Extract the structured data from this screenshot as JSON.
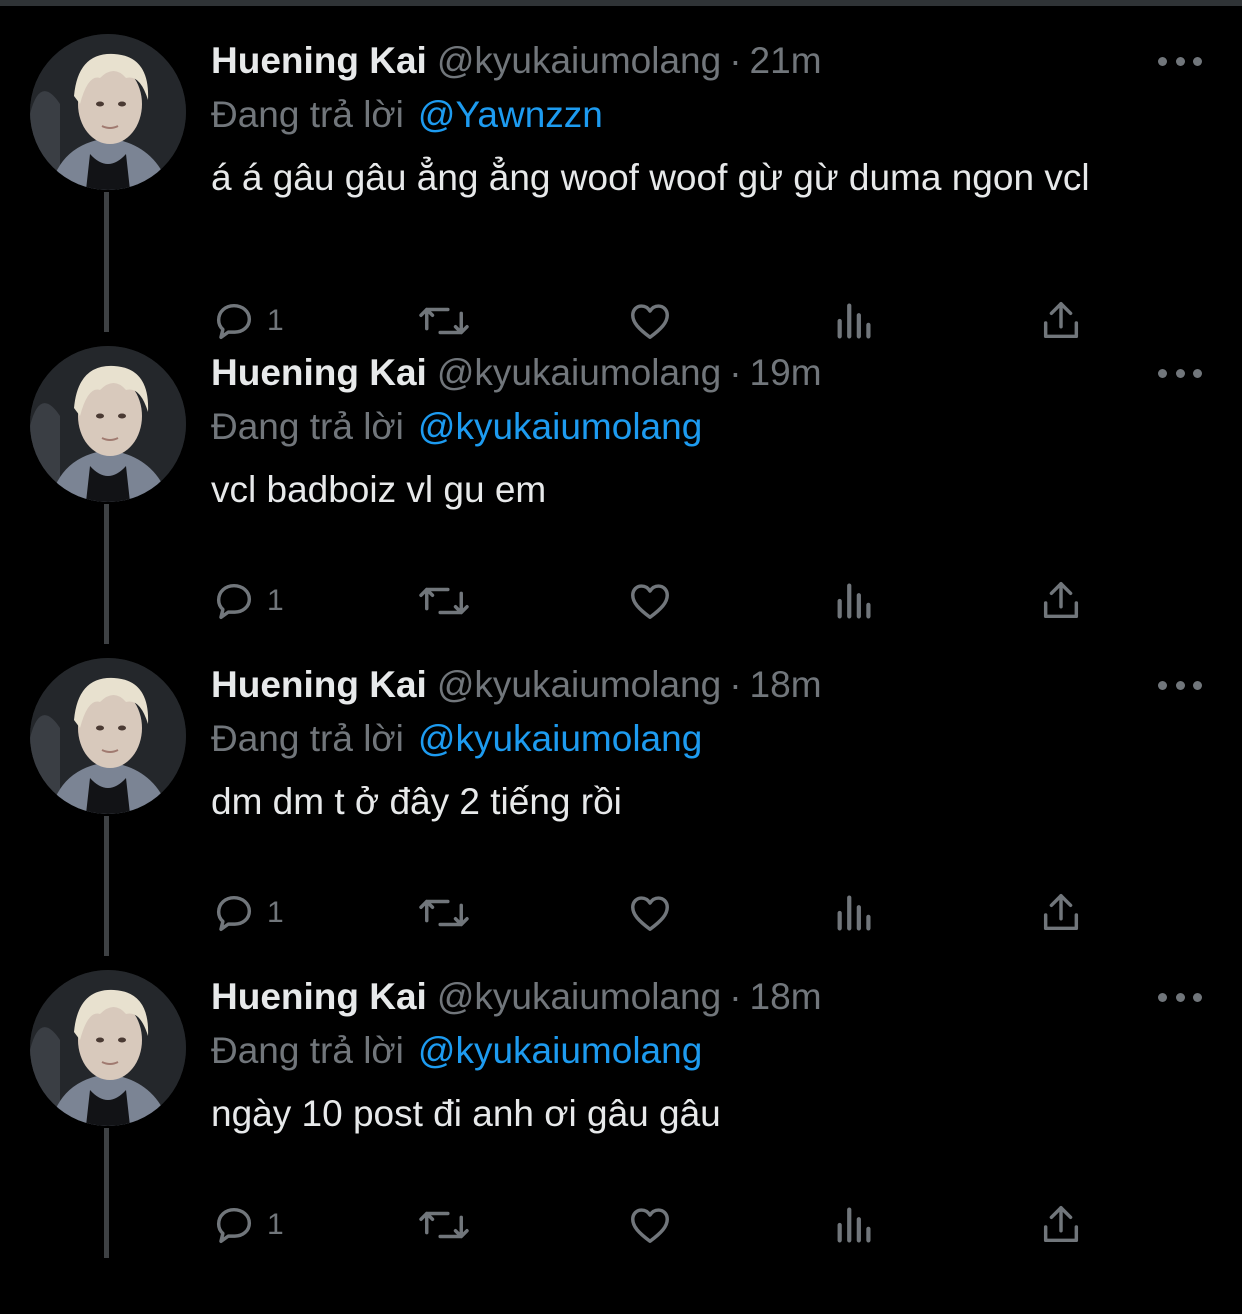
{
  "colors": {
    "background": "#000000",
    "text": "#e7e9ea",
    "muted": "#71767b",
    "link": "#1d9bf0",
    "thread_line": "#3e4144"
  },
  "icons": {
    "reply": "reply-bubble-icon",
    "retweet": "retweet-arrows-icon",
    "like": "heart-icon",
    "views": "bar-chart-icon",
    "share": "share-upload-icon",
    "more": "more-dots-icon"
  },
  "reply_prefix": "Đang trả lời",
  "tweets": [
    {
      "name": "Huening Kai",
      "handle": "@kyukaiumolang",
      "dot": "·",
      "time": "21m",
      "reply_to": "@Yawnzzn",
      "text": "á á gâu gâu ẳng ẳng woof woof gừ gừ duma ngon vcl",
      "reply_count": "1"
    },
    {
      "name": "Huening Kai",
      "handle": "@kyukaiumolang",
      "dot": "·",
      "time": "19m",
      "reply_to": "@kyukaiumolang",
      "text": "vcl badboiz vl gu em",
      "reply_count": "1"
    },
    {
      "name": "Huening Kai",
      "handle": "@kyukaiumolang",
      "dot": "·",
      "time": "18m",
      "reply_to": "@kyukaiumolang",
      "text": "dm dm t ở đây 2 tiếng rồi",
      "reply_count": "1"
    },
    {
      "name": "Huening Kai",
      "handle": "@kyukaiumolang",
      "dot": "·",
      "time": "18m",
      "reply_to": "@kyukaiumolang",
      "text": "ngày 10 post đi anh ơi gâu gâu",
      "reply_count": "1"
    }
  ]
}
